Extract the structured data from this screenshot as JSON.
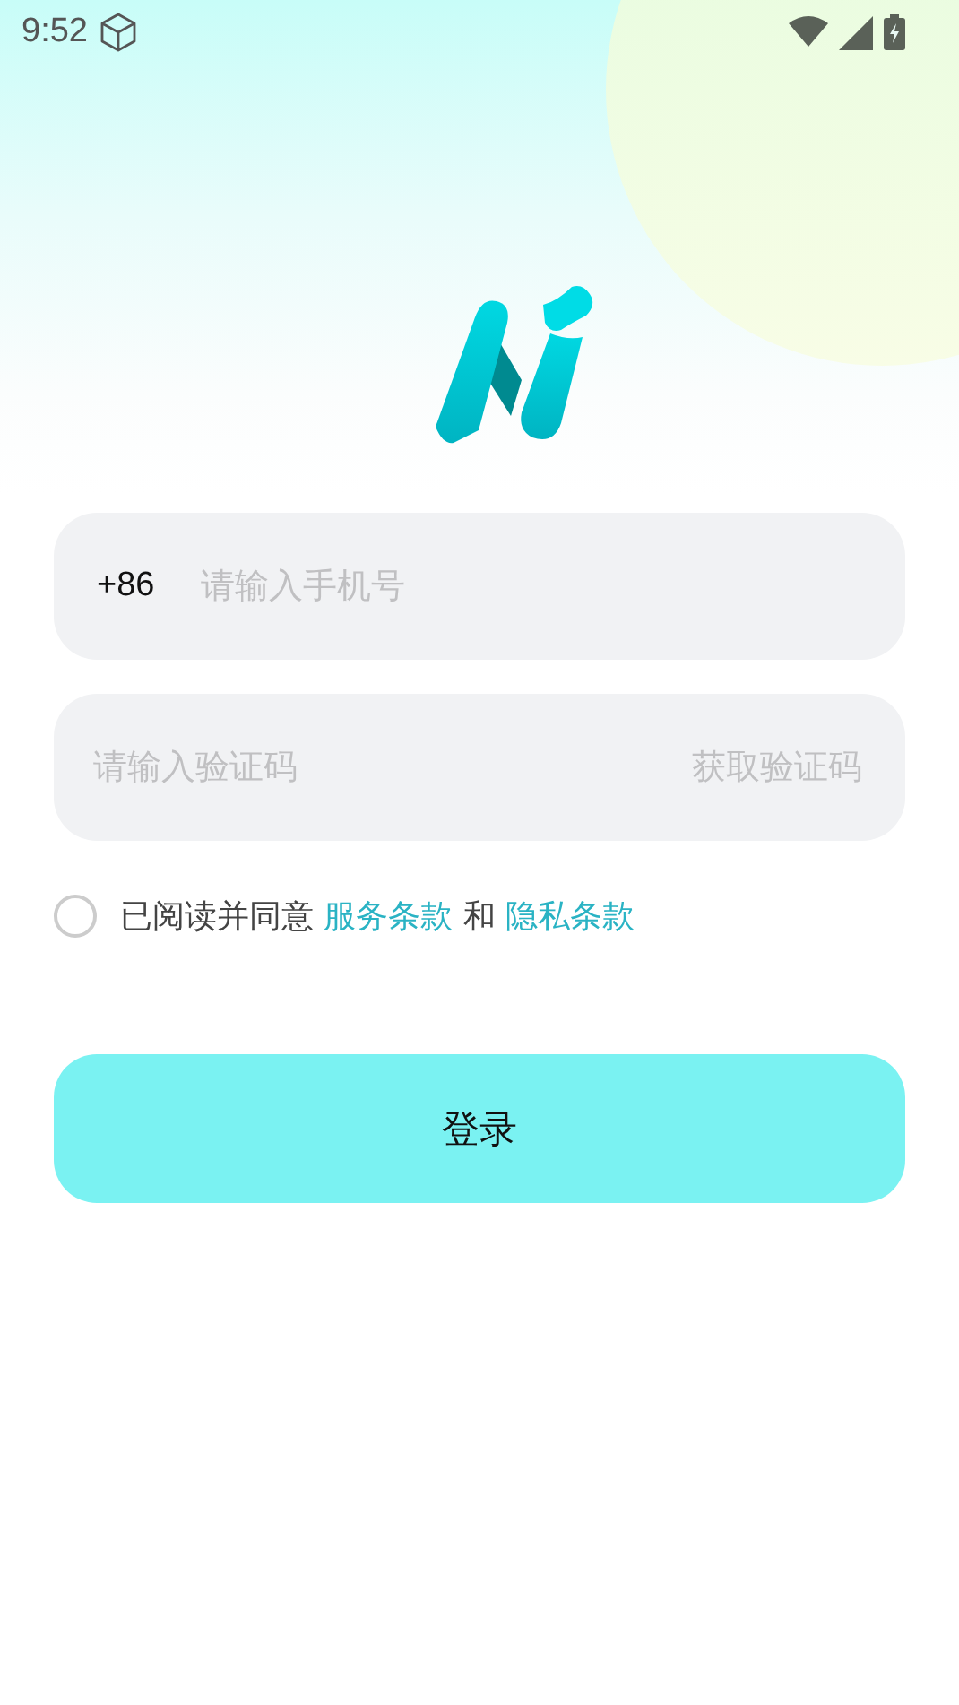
{
  "status_bar": {
    "time": "9:52"
  },
  "phone_field": {
    "country_code": "+86",
    "placeholder": "请输入手机号"
  },
  "code_field": {
    "placeholder": "请输入验证码",
    "action": "获取验证码"
  },
  "agreement": {
    "checked": false,
    "prefix": "已阅读并同意",
    "links": [
      "服务条款",
      "隐私条款"
    ],
    "conjunction": "和"
  },
  "login_button": {
    "label": "登录"
  }
}
